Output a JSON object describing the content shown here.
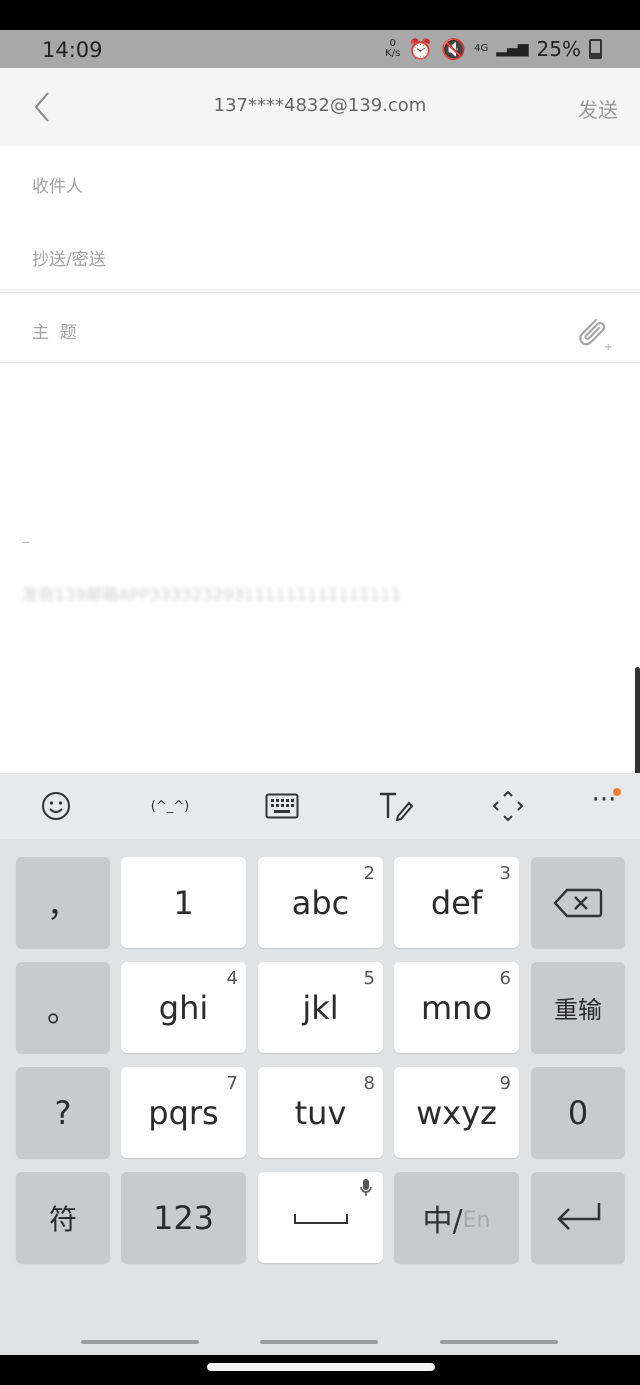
{
  "status_bar": {
    "time": "14:09",
    "net_speed_top": "0",
    "net_speed_bottom": "K/s",
    "network": "4G",
    "battery": "25%"
  },
  "header": {
    "title": "137****4832@139.com",
    "send_label": "发送"
  },
  "form": {
    "to_label": "收件人",
    "cc_bcc_label": "抄送/密送",
    "subject_label": "主  题"
  },
  "body": {
    "dash": "–",
    "signature": "发自139邮箱APP333323293111111111111111"
  },
  "keyboard": {
    "toolbar": {
      "emoticon": "(^_^)"
    },
    "keys": {
      "comma": "，",
      "period": "。",
      "question": "?",
      "symbols": "符",
      "key1": "1",
      "abc": "abc",
      "abc_num": "2",
      "def": "def",
      "def_num": "3",
      "ghi": "ghi",
      "ghi_num": "4",
      "jkl": "jkl",
      "jkl_num": "5",
      "mno": "mno",
      "mno_num": "6",
      "pqrs": "pqrs",
      "pqrs_num": "7",
      "tuv": "tuv",
      "tuv_num": "8",
      "wxyz": "wxyz",
      "wxyz_num": "9",
      "reenter": "重输",
      "zero": "0",
      "num_switch": "123",
      "lang_cn": "中/",
      "lang_en": "En"
    }
  },
  "colors": {
    "accent_dot": "#ef7d3c",
    "status_bar_bg": "#a8a8a8",
    "keyboard_bg": "#e1e2e4"
  }
}
